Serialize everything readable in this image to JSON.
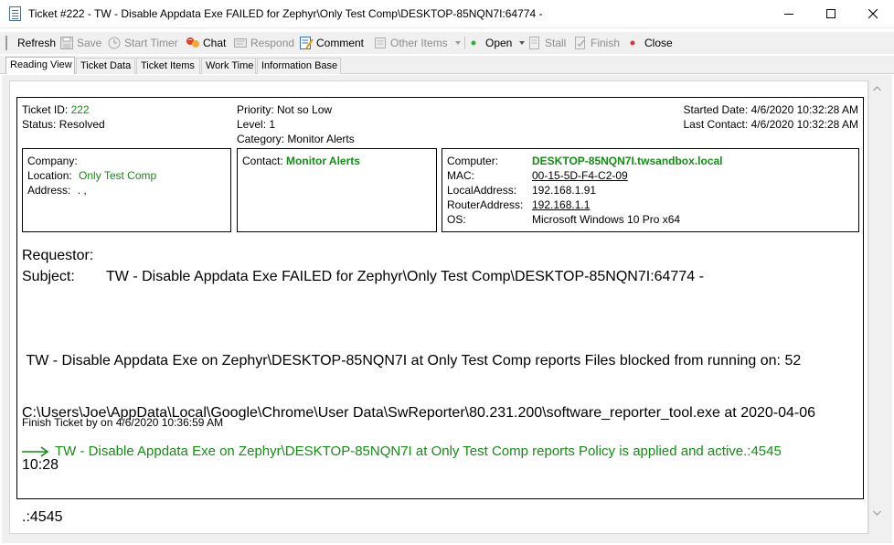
{
  "window": {
    "title": "Ticket #222 - TW - Disable Appdata Exe FAILED for Zephyr\\Only Test Comp\\DESKTOP-85NQN7I:64774 -"
  },
  "toolbar": {
    "refresh": "Refresh",
    "save": "Save",
    "start_timer": "Start Timer",
    "chat": "Chat",
    "respond": "Respond",
    "comment": "Comment",
    "other_items": "Other Items",
    "open": "Open",
    "stall": "Stall",
    "finish": "Finish",
    "close": "Close"
  },
  "tabs": [
    "Reading View",
    "Ticket Data",
    "Ticket Items",
    "Work Time",
    "Information Base"
  ],
  "ticket": {
    "id_label": "Ticket ID:",
    "id_value": "222",
    "status_label": "Status:",
    "status_value": "Resolved",
    "priority_label": "Priority:",
    "priority_value": "Not so Low",
    "level_label": "Level:",
    "level_value": "1",
    "category_label": "Category:",
    "category_value": "Monitor Alerts",
    "started_label": "Started Date:",
    "started_value": "4/6/2020 10:32:28 AM",
    "last_contact_label": "Last Contact:",
    "last_contact_value": "4/6/2020 10:32:28 AM"
  },
  "company_box": {
    "company_label": "Company:",
    "company_value": "",
    "location_label": "Location:",
    "location_value": "Only Test Comp",
    "address_label": "Address:",
    "address_value": ". ,"
  },
  "contact_box": {
    "contact_label": "Contact:",
    "contact_value": "Monitor Alerts"
  },
  "computer_box": {
    "computer_label": "Computer:",
    "computer_value": "DESKTOP-85NQN7I.twsandbox.local",
    "mac_label": "MAC:",
    "mac_value": "00-15-5D-F4-C2-09",
    "local_label": "LocalAddress:",
    "local_value": "192.168.1.91",
    "router_label": "RouterAddress:",
    "router_value": "192.168.1.1",
    "os_label": "OS:",
    "os_value": "Microsoft Windows 10 Pro x64"
  },
  "requestor_label": "Requestor:",
  "subject_label": "Subject:",
  "subject_value": "TW - Disable Appdata Exe FAILED for Zephyr\\Only Test Comp\\DESKTOP-85NQN7I:64774 -",
  "body": {
    "line1": " TW - Disable Appdata Exe on Zephyr\\DESKTOP-85NQN7I at Only Test Comp reports Files blocked from running on: 52",
    "line2": "C:\\Users\\Joe\\AppData\\Local\\Google\\Chrome\\User Data\\SwReporter\\80.231.200\\software_reporter_tool.exe at 2020-04-06",
    "line3": "10:28",
    "line4": ".:4545"
  },
  "finish_line": "Finish Ticket by on 4/6/2020 10:36:59 AM",
  "resolution": "TW - Disable Appdata Exe on Zephyr\\DESKTOP-85NQN7I at Only Test Comp reports Policy is applied and active.:4545",
  "colors": {
    "green": "#178a17",
    "open_dot": "#3aa83a",
    "close_dot": "#d23a3a"
  }
}
